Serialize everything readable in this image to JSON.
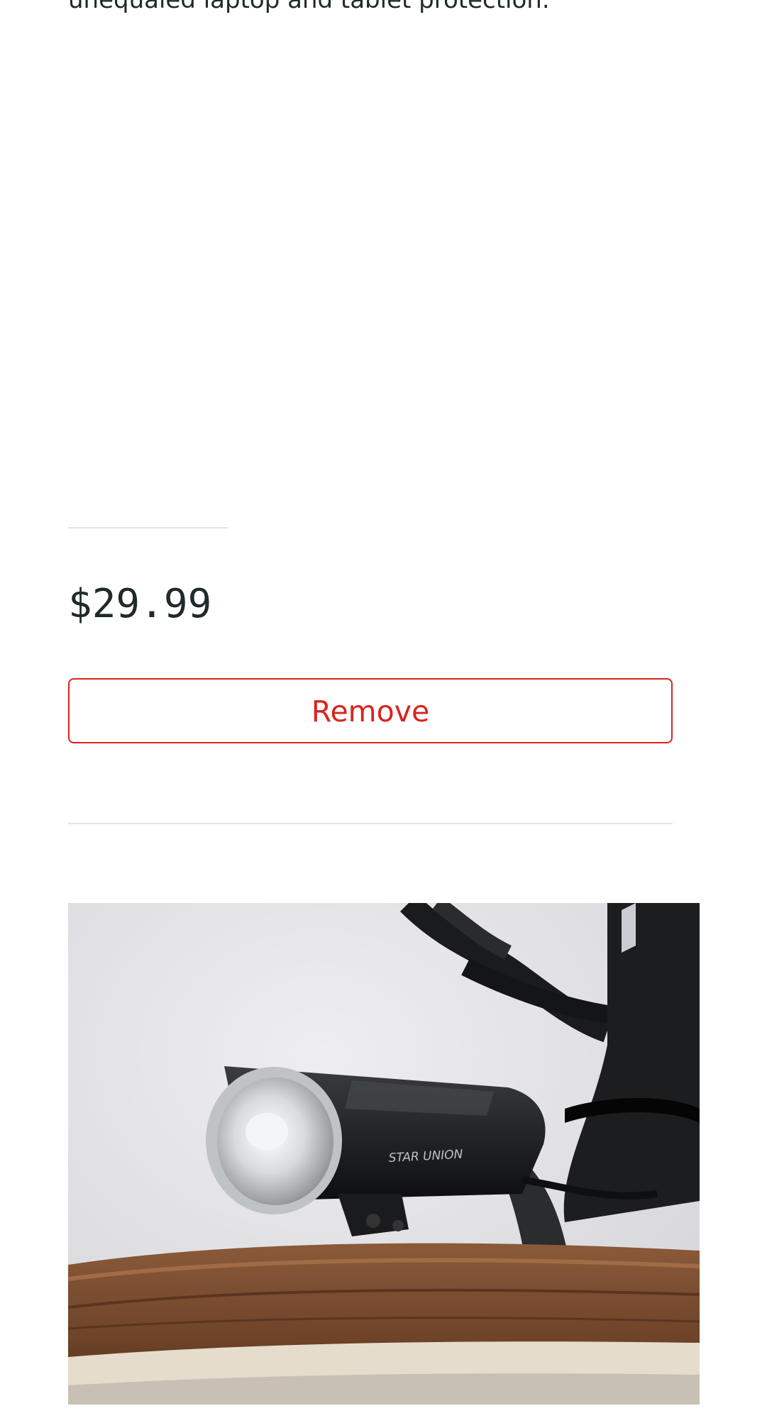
{
  "product": {
    "description_tail": "unequaled laptop and tablet protection.",
    "price": "$29.99",
    "remove_label": "Remove"
  },
  "next_product": {
    "image_icon": "bicycle-headlight-photo",
    "image_alt": "STAR UNION"
  },
  "colors": {
    "accent": "#d7251f",
    "text": "#1f2a2a",
    "divider": "#e4e4e4"
  }
}
